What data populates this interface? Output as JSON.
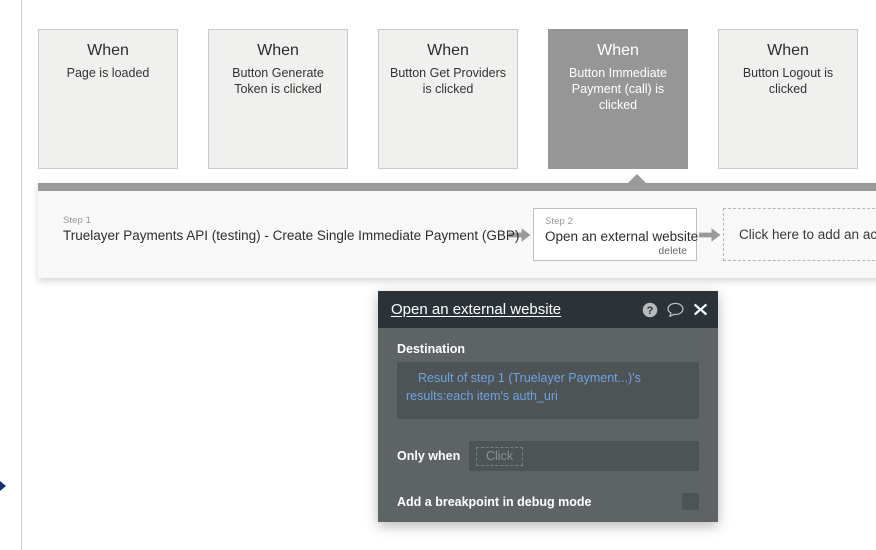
{
  "events": [
    {
      "when": "When",
      "desc": "Page is loaded",
      "selected": false
    },
    {
      "when": "When",
      "desc": "Button Generate Token is clicked",
      "selected": false
    },
    {
      "when": "When",
      "desc": "Button Get Providers is clicked",
      "selected": false
    },
    {
      "when": "When",
      "desc": "Button Immediate Payment (call) is clicked",
      "selected": true
    },
    {
      "when": "When",
      "desc": "Button Logout is clicked",
      "selected": false
    }
  ],
  "workflow": {
    "step1": {
      "label": "Step 1",
      "title": "Truelayer Payments API (testing) - Create Single Immediate Payment (GBP)"
    },
    "step2": {
      "label": "Step 2",
      "title": "Open an external website",
      "delete_label": "delete"
    },
    "add_action": "Click here to add an action"
  },
  "property_editor": {
    "title": "Open an external website",
    "icons": {
      "help": "help-circle-icon",
      "comment": "comment-bubble-icon",
      "close": "close-icon"
    },
    "destination": {
      "label": "Destination",
      "value": "Result of step 1 (Truelayer Payment...)'s results:each item's auth_uri"
    },
    "only_when": {
      "label": "Only when",
      "placeholder": "Click"
    },
    "breakpoint": {
      "label": "Add a breakpoint in debug mode",
      "checked": false
    }
  },
  "colors": {
    "selected_event_bg": "#969696",
    "panel_bg": "#5e6366",
    "panel_header_bg": "#2b3338",
    "expression_blue": "#6ea3e0",
    "workflow_bar": "#9a9a9a"
  }
}
